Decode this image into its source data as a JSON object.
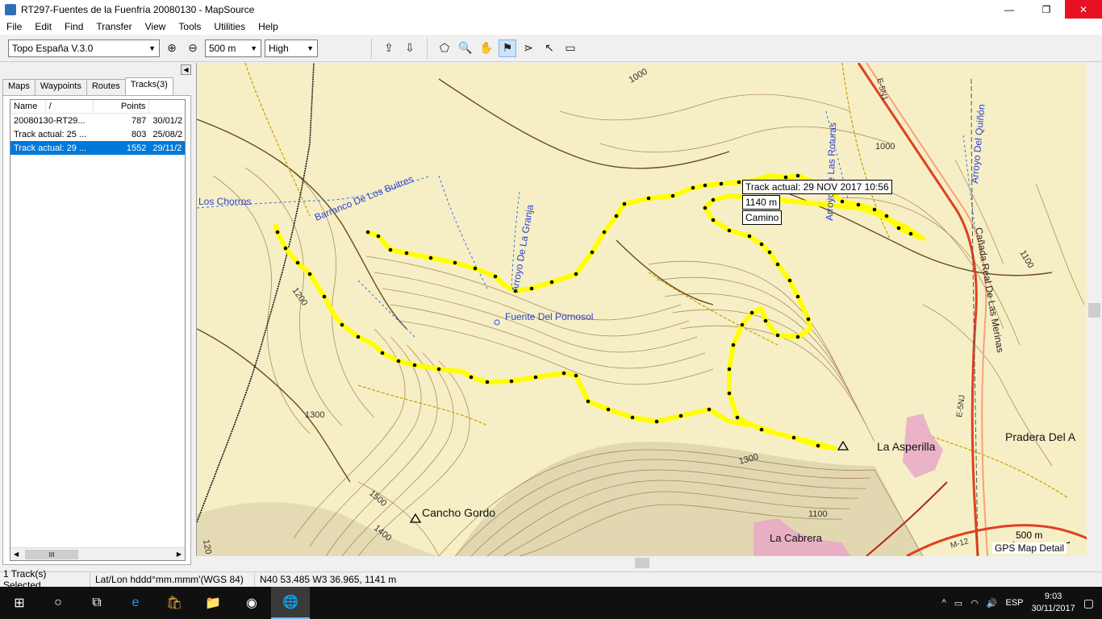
{
  "window": {
    "title": "RT297-Fuentes de la Fuenfría 20080130 - MapSource",
    "minimize": "—",
    "maximize": "❐",
    "close": "✕"
  },
  "menu": [
    "File",
    "Edit",
    "Find",
    "Transfer",
    "View",
    "Tools",
    "Utilities",
    "Help"
  ],
  "toolbar": {
    "map_product": "Topo España V.3.0",
    "zoom_scale": "500 m",
    "detail": "High"
  },
  "tabs": [
    "Maps",
    "Waypoints",
    "Routes",
    "Tracks(3)"
  ],
  "tracks": {
    "columns": [
      "Name",
      "/",
      "Points",
      ""
    ],
    "rows": [
      {
        "name": "20080130-RT29...",
        "points": "787",
        "date": "30/01/2",
        "selected": false
      },
      {
        "name": "Track actual: 25 ...",
        "points": "803",
        "date": "25/08/2",
        "selected": false
      },
      {
        "name": "Track actual: 29 ...",
        "points": "1552",
        "date": "29/11/2",
        "selected": true
      }
    ],
    "scroll_thumb": "III"
  },
  "map": {
    "labels": {
      "chorros": "Los Chorros",
      "buitres": "Barranco De Los Buitres",
      "granja": "Arroyo De La Granja",
      "pornosol": "Fuente Del Pornosol",
      "roturas": "Arroyo De Las Roturas",
      "quinon": "Arroyo Del Quiñón",
      "canada": "Cañada Real De Las Merinas",
      "asperilla": "La Asperilla",
      "cancho": "Cancho Gordo",
      "cabrera": "La Cabrera",
      "pradera": "Pradera Del A",
      "e5n1": "E-5N1",
      "e5nj": "E-5NJ",
      "m12": "M-12"
    },
    "contours": [
      "1000",
      "1000",
      "1100",
      "1200",
      "1300",
      "1300",
      "1500",
      "1400",
      "1100",
      "120"
    ],
    "tooltip": {
      "title": "Track actual: 29 NOV 2017 10:56",
      "elevation": "1140 m",
      "type": "Camino"
    },
    "scale_label": "500 m",
    "detail_label": "GPS Map Detail"
  },
  "status": {
    "selection": "1 Track(s) Selected",
    "format": "Lat/Lon hddd°mm.mmm'(WGS 84)",
    "position": "N40 53.485 W3 36.965, 1141 m"
  },
  "taskbar": {
    "language": "ESP",
    "time": "9:03",
    "date": "30/11/2017"
  },
  "colors": {
    "map_bg": "#f6efc6",
    "track": "#ffff00",
    "contour": "#8b5a2b",
    "selection": "#0078d7"
  }
}
